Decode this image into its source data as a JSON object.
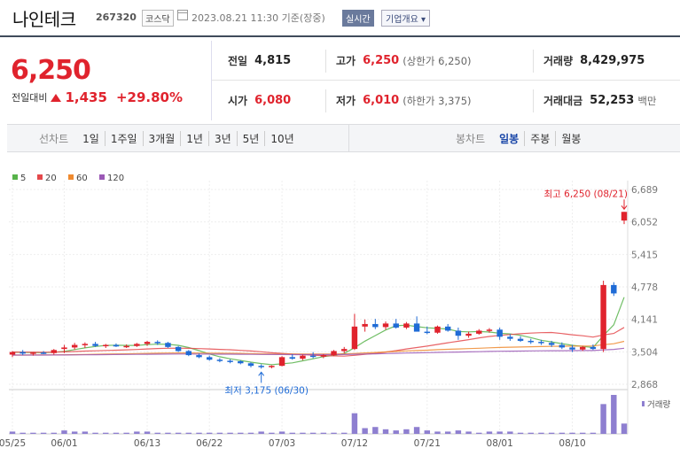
{
  "header": {
    "name": "나인테크",
    "code": "267320",
    "market": "코스닥",
    "timestamp": "2023.08.21 11:30 기준(장중)",
    "realtime_label": "실시간",
    "company_info_label": "기업개요 ▾"
  },
  "price": {
    "current": "6,250",
    "change_label": "전일대비",
    "change": "1,435",
    "change_pct": "+29.80%"
  },
  "stats": {
    "prev_label": "전일",
    "prev": "4,815",
    "high_label": "고가",
    "high": "6,250",
    "upper_limit": "(상한가 6,250)",
    "volume_label": "거래량",
    "volume": "8,429,975",
    "open_label": "시가",
    "open": "6,080",
    "low_label": "저가",
    "low": "6,010",
    "lower_limit": "(하한가 3,375)",
    "amount_label": "거래대금",
    "amount": "52,253",
    "amount_unit": "백만"
  },
  "tabs": {
    "line_label": "선차트",
    "line_periods": [
      "1일",
      "1주일",
      "3개월",
      "1년",
      "3년",
      "5년",
      "10년"
    ],
    "candle_label": "봉차트",
    "candle_periods": [
      "일봉",
      "주봉",
      "월봉"
    ],
    "candle_active": "일봉"
  },
  "colors": {
    "up": "#e0232d",
    "down": "#1f6bd6",
    "ma5": "#57b34a",
    "ma20": "#e4484b",
    "ma60": "#ef8a2f",
    "ma120": "#9b59b6"
  },
  "chart_data": {
    "type": "candlestick",
    "legend": [
      {
        "name": "5",
        "color": "#57b34a"
      },
      {
        "name": "20",
        "color": "#e4484b"
      },
      {
        "name": "60",
        "color": "#ef8a2f"
      },
      {
        "name": "120",
        "color": "#9b59b6"
      }
    ],
    "y_ticks": [
      "6,689",
      "6,052",
      "5,415",
      "4,778",
      "4,141",
      "3,504",
      "2,868"
    ],
    "ylim": [
      2868,
      6689
    ],
    "x_tick_labels": [
      "05/25",
      "06/01",
      "06/13",
      "06/22",
      "07/03",
      "07/12",
      "07/21",
      "08/01",
      "08/10"
    ],
    "x_tick_index": [
      0,
      5,
      13,
      19,
      26,
      33,
      40,
      47,
      54
    ],
    "annotation_high": "최고 6,250 (08/21)",
    "annotation_low": "최저 3,175 (06/30)",
    "volume_label": "거래량",
    "candles": [
      [
        3450,
        3520,
        3400,
        3500
      ],
      [
        3500,
        3540,
        3440,
        3470
      ],
      [
        3470,
        3500,
        3430,
        3490
      ],
      [
        3490,
        3520,
        3460,
        3480
      ],
      [
        3480,
        3560,
        3450,
        3540
      ],
      [
        3560,
        3640,
        3480,
        3590
      ],
      [
        3590,
        3680,
        3550,
        3640
      ],
      [
        3640,
        3690,
        3580,
        3660
      ],
      [
        3660,
        3700,
        3600,
        3620
      ],
      [
        3620,
        3660,
        3580,
        3640
      ],
      [
        3640,
        3670,
        3600,
        3610
      ],
      [
        3610,
        3650,
        3580,
        3620
      ],
      [
        3620,
        3680,
        3600,
        3660
      ],
      [
        3660,
        3720,
        3620,
        3700
      ],
      [
        3700,
        3730,
        3640,
        3680
      ],
      [
        3680,
        3700,
        3580,
        3600
      ],
      [
        3600,
        3620,
        3500,
        3520
      ],
      [
        3520,
        3540,
        3420,
        3440
      ],
      [
        3440,
        3470,
        3380,
        3400
      ],
      [
        3400,
        3430,
        3330,
        3350
      ],
      [
        3350,
        3380,
        3300,
        3330
      ],
      [
        3330,
        3360,
        3280,
        3320
      ],
      [
        3320,
        3340,
        3260,
        3280
      ],
      [
        3280,
        3300,
        3200,
        3230
      ],
      [
        3230,
        3260,
        3175,
        3210
      ],
      [
        3210,
        3240,
        3180,
        3230
      ],
      [
        3230,
        3420,
        3220,
        3400
      ],
      [
        3400,
        3460,
        3350,
        3370
      ],
      [
        3370,
        3450,
        3340,
        3430
      ],
      [
        3430,
        3500,
        3380,
        3410
      ],
      [
        3410,
        3460,
        3380,
        3440
      ],
      [
        3440,
        3540,
        3420,
        3520
      ],
      [
        3520,
        3600,
        3480,
        3560
      ],
      [
        3560,
        4250,
        3540,
        4000
      ],
      [
        4000,
        4140,
        3900,
        4050
      ],
      [
        4050,
        4150,
        3950,
        3990
      ],
      [
        3990,
        4100,
        3940,
        4060
      ],
      [
        4060,
        4150,
        3960,
        3980
      ],
      [
        3980,
        4090,
        3950,
        4060
      ],
      [
        4060,
        4200,
        3920,
        3900
      ],
      [
        3900,
        4000,
        3850,
        3880
      ],
      [
        3880,
        4020,
        3860,
        4000
      ],
      [
        4000,
        4050,
        3900,
        3920
      ],
      [
        3920,
        3980,
        3740,
        3820
      ],
      [
        3820,
        3900,
        3780,
        3860
      ],
      [
        3860,
        3950,
        3840,
        3920
      ],
      [
        3920,
        3970,
        3880,
        3940
      ],
      [
        3940,
        3980,
        3740,
        3800
      ],
      [
        3800,
        3850,
        3720,
        3760
      ],
      [
        3760,
        3810,
        3700,
        3720
      ],
      [
        3720,
        3760,
        3660,
        3700
      ],
      [
        3700,
        3740,
        3640,
        3680
      ],
      [
        3680,
        3720,
        3600,
        3640
      ],
      [
        3640,
        3690,
        3560,
        3590
      ],
      [
        3590,
        3640,
        3500,
        3550
      ],
      [
        3550,
        3620,
        3520,
        3600
      ],
      [
        3600,
        3650,
        3540,
        3560
      ],
      [
        3560,
        4900,
        3500,
        4815
      ],
      [
        4815,
        4870,
        4600,
        4650
      ],
      [
        6080,
        6250,
        6010,
        6250
      ]
    ],
    "volumes": [
      2,
      1,
      1,
      1,
      1,
      3,
      2,
      2,
      1,
      1,
      1,
      1,
      2,
      2,
      1,
      1,
      1,
      1,
      1,
      1,
      1,
      1,
      1,
      1,
      2,
      1,
      2,
      1,
      1,
      1,
      1,
      1,
      1,
      18,
      5,
      6,
      4,
      3,
      4,
      6,
      3,
      2,
      2,
      3,
      2,
      1,
      2,
      2,
      2,
      1,
      1,
      1,
      1,
      1,
      1,
      1,
      1,
      26,
      34,
      9
    ]
  }
}
